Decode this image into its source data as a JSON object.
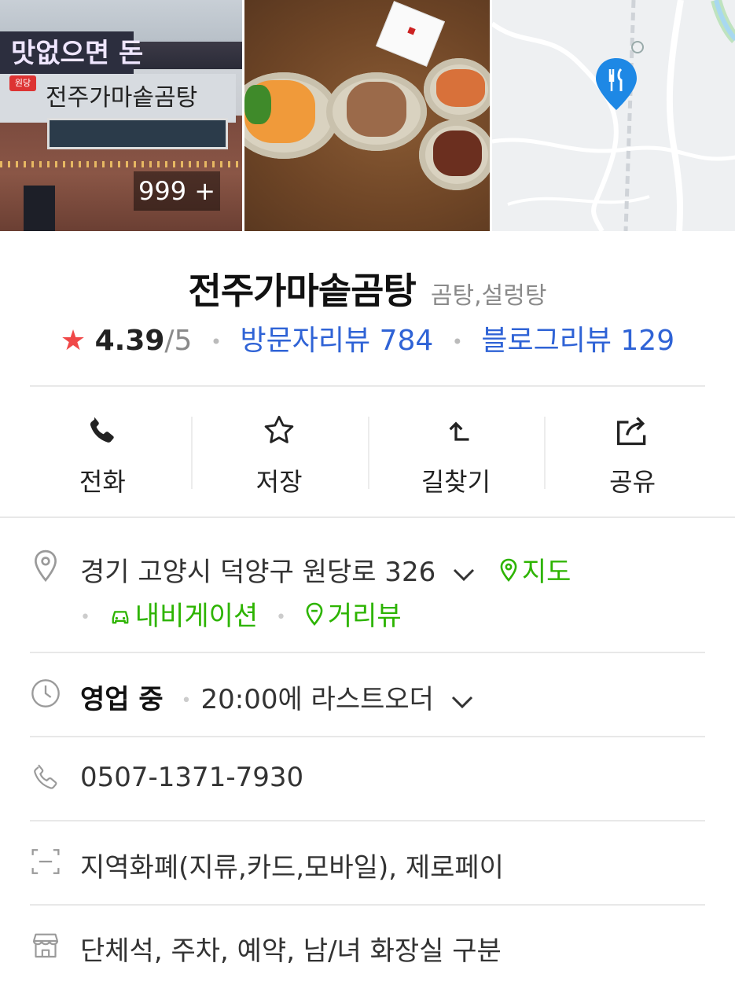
{
  "photos": {
    "count_label": "999 +"
  },
  "place": {
    "name": "전주가마솥곰탕",
    "category": "곰탕,설렁탕",
    "rating": "4.39",
    "rating_max": "/5",
    "visitor_reviews_label": "방문자리뷰 784",
    "blog_reviews_label": "블로그리뷰 129"
  },
  "actions": [
    {
      "label": "전화",
      "icon": "phone-icon"
    },
    {
      "label": "저장",
      "icon": "star-icon"
    },
    {
      "label": "길찾기",
      "icon": "directions-icon"
    },
    {
      "label": "공유",
      "icon": "share-icon"
    }
  ],
  "address": {
    "text": "경기 고양시 덕양구 원당로 326",
    "map_label": "지도",
    "navigation_label": "내비게이션",
    "streetview_label": "거리뷰"
  },
  "hours": {
    "status": "영업 중",
    "detail": "20:00에 라스트오더"
  },
  "phone": {
    "number": "0507-1371-7930"
  },
  "payment": {
    "text": "지역화폐(지류,카드,모바일), 제로페이"
  },
  "facilities": {
    "text": "단체석, 주차, 예약, 남/녀 화장실 구분"
  },
  "colors": {
    "link": "#2f63d6",
    "green": "#2db400",
    "star": "#f04848",
    "map_pin": "#1e88e5"
  }
}
